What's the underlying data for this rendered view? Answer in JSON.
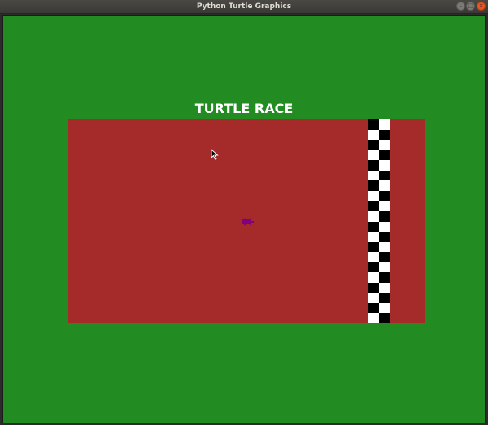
{
  "window": {
    "title": "Python Turtle Graphics",
    "minimize_glyph": "–",
    "maximize_glyph": "□",
    "close_glyph": "×"
  },
  "canvas": {
    "background_color": "#228b22",
    "heading": "TURTLE RACE",
    "heading_color": "#ffffff"
  },
  "track": {
    "color": "#a52a2a"
  },
  "finish_line": {
    "colors": [
      "#000000",
      "#ffffff"
    ]
  },
  "turtle": {
    "color": "#800080",
    "icon": "turtle-icon"
  },
  "cursor": {
    "icon": "mouse-pointer-icon"
  }
}
